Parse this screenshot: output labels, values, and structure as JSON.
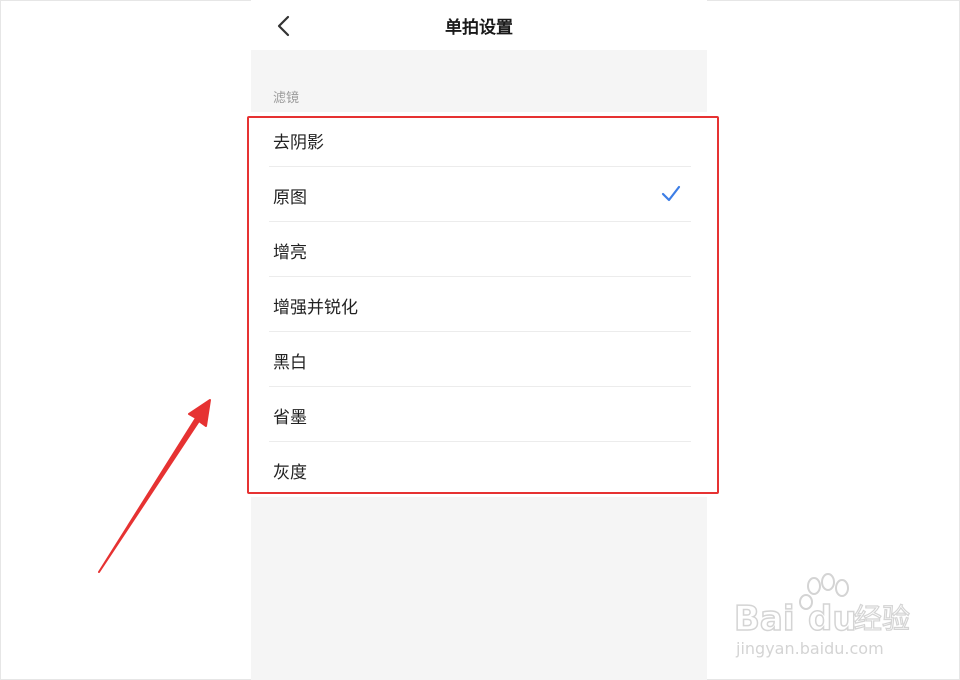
{
  "header": {
    "title": "单拍设置"
  },
  "filters": {
    "section_label": "滤镜",
    "items": [
      {
        "label": "去阴影",
        "selected": false
      },
      {
        "label": "原图",
        "selected": true
      },
      {
        "label": "增亮",
        "selected": false
      },
      {
        "label": "增强并锐化",
        "selected": false
      },
      {
        "label": "黑白",
        "selected": false
      },
      {
        "label": "省墨",
        "selected": false
      },
      {
        "label": "灰度",
        "selected": false
      }
    ]
  },
  "colors": {
    "accent": "#3d7ee6",
    "annotation": "#e63232",
    "background": "#f5f5f5"
  },
  "icons": {
    "back": "chevron-left-icon",
    "selected": "checkmark-icon"
  }
}
